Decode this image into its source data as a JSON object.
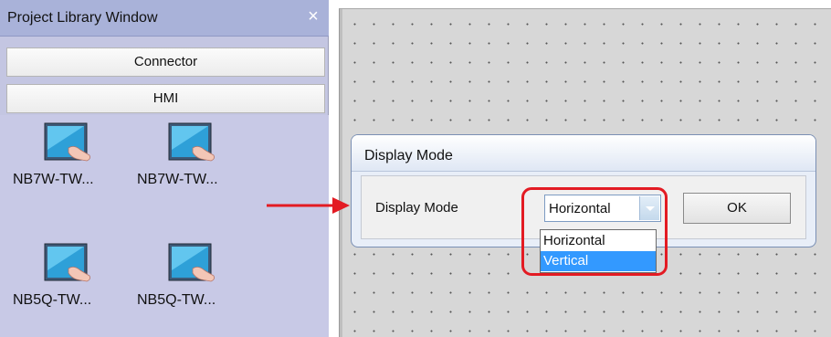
{
  "library": {
    "title": "Project Library Window",
    "close_glyph": "×",
    "categories": [
      "Connector",
      "HMI"
    ],
    "items": [
      {
        "label": "NB7W-TW...",
        "icon": "hmi-touchscreen-icon"
      },
      {
        "label": "NB7W-TW...",
        "icon": "hmi-touchscreen-icon"
      },
      {
        "label": "NB5Q-TW...",
        "icon": "hmi-touchscreen-icon"
      },
      {
        "label": "NB5Q-TW...",
        "icon": "hmi-touchscreen-icon"
      }
    ]
  },
  "dialog": {
    "title": "Display Mode",
    "label": "Display Mode",
    "selected": "Horizontal",
    "options": [
      "Horizontal",
      "Vertical"
    ],
    "highlighted_option": "Vertical",
    "ok_label": "OK"
  },
  "colors": {
    "panel_bg": "#c8c9e6",
    "panel_title_bg": "#a9b2d9",
    "selection": "#3399ff",
    "annotation_red": "#e31b23"
  }
}
